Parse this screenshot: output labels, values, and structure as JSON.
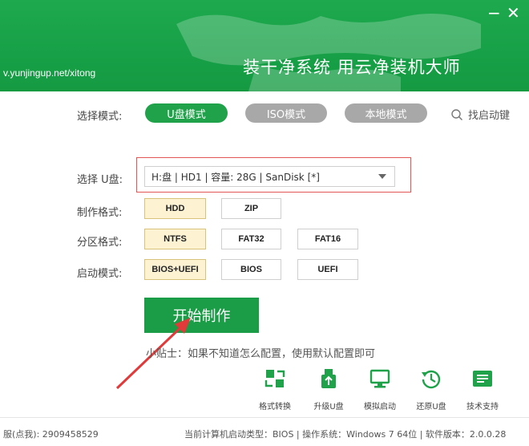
{
  "header": {
    "url": "v.yunjingup.net/xitong",
    "title": "装干净系统  用云净装机大师",
    "minimize": "−",
    "close": "✕"
  },
  "mode": {
    "label": "选择模式:",
    "tabs": [
      "U盘模式",
      "ISO模式",
      "本地模式"
    ],
    "active_index": 0,
    "find_label": "找启动键"
  },
  "usb": {
    "label": "选择 U盘:",
    "selected": "H:盘 | HD1 | 容量: 28G | SanDisk [*]"
  },
  "format": {
    "label": "制作格式:",
    "options": [
      "HDD",
      "ZIP"
    ],
    "selected": "HDD"
  },
  "partition": {
    "label": "分区格式:",
    "options": [
      "NTFS",
      "FAT32",
      "FAT16"
    ],
    "selected": "NTFS"
  },
  "boot": {
    "label": "启动模式:",
    "options": [
      "BIOS+UEFI",
      "BIOS",
      "UEFI"
    ],
    "selected": "BIOS+UEFI"
  },
  "start_button": "开始制作",
  "tip": "小贴士：如果不知道怎么配置，使用默认配置即可",
  "tools": [
    {
      "label": "格式转换",
      "icon": "format-convert-icon"
    },
    {
      "label": "升级U盘",
      "icon": "upgrade-usb-icon"
    },
    {
      "label": "模拟启动",
      "icon": "simulate-boot-icon"
    },
    {
      "label": "还原U盘",
      "icon": "restore-usb-icon"
    },
    {
      "label": "技术支持",
      "icon": "tech-support-icon"
    }
  ],
  "footer": {
    "left": "服(点我): 2909458529",
    "right": "当前计算机启动类型：BIOS | 操作系统：Windows 7 64位 | 软件版本：2.0.0.28"
  },
  "colors": {
    "brand_green": "#1fa24a",
    "inactive_gray": "#a8a8a8",
    "highlight_red": "#e35656",
    "selected_bg": "#fdf3d3"
  }
}
